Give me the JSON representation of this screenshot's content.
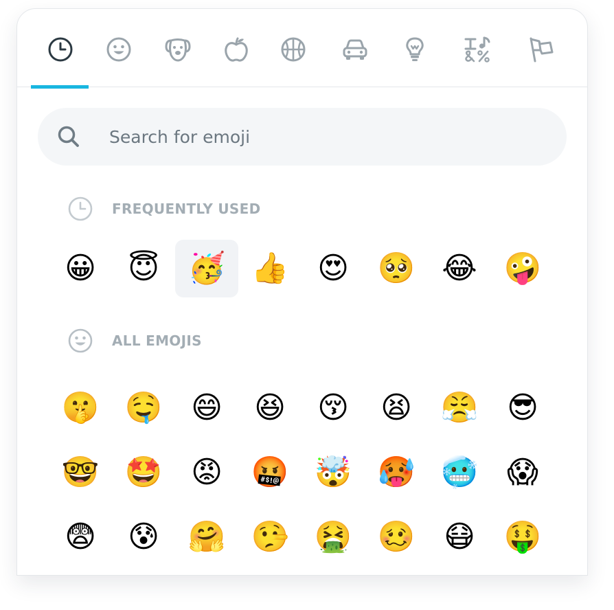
{
  "tabs": [
    {
      "name": "recent",
      "icon": "clock-icon",
      "active": true
    },
    {
      "name": "smileys",
      "icon": "smiley-icon",
      "active": false
    },
    {
      "name": "animals",
      "icon": "dog-icon",
      "active": false
    },
    {
      "name": "food",
      "icon": "apple-icon",
      "active": false
    },
    {
      "name": "activity",
      "icon": "basketball-icon",
      "active": false
    },
    {
      "name": "travel",
      "icon": "car-icon",
      "active": false
    },
    {
      "name": "objects",
      "icon": "lightbulb-icon",
      "active": false
    },
    {
      "name": "symbols",
      "icon": "symbols-icon",
      "active": false
    },
    {
      "name": "flags",
      "icon": "flag-icon",
      "active": false
    }
  ],
  "colors": {
    "accent": "#19b6e0",
    "active_icon": "#2b3942",
    "inactive_icon": "#9aa4ab",
    "section_title": "#a3adb4",
    "search_bg": "#f4f6f8"
  },
  "search": {
    "placeholder": "Search for emoji",
    "value": ""
  },
  "sections": {
    "frequent": {
      "title": "FREQUENTLY USED",
      "icon": "clock-icon",
      "emojis": [
        "😀",
        "😇",
        "🥳",
        "👍",
        "😍",
        "🥺",
        "😂",
        "🤪"
      ],
      "selected_index": 2
    },
    "all": {
      "title": "ALL EMOJIS",
      "icon": "smiley-icon",
      "emojis": [
        "🤫",
        "🤤",
        "😄",
        "😆",
        "😚",
        "😫",
        "😤",
        "😎",
        "🤓",
        "🤩",
        "😡",
        "🤬",
        "🤯",
        "🥵",
        "🥶",
        "😱",
        "😨",
        "😰",
        "🤗",
        "🤥",
        "🤮",
        "🥴",
        "😷",
        "🤑"
      ]
    }
  }
}
